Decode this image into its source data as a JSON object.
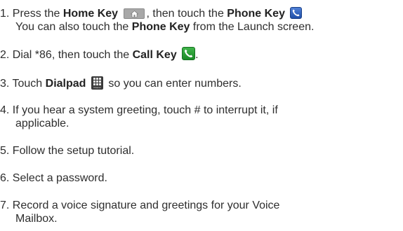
{
  "steps": [
    {
      "line1_pre": "1. Press the ",
      "home_key": "Home Key",
      "line1_mid": ", then touch the ",
      "phone_key": "Phone Key",
      "line2_pre": "You can also touch the ",
      "phone_key_2": "Phone Key",
      "line2_post": " from the Launch screen."
    },
    {
      "pre": "2. Dial *86, then touch the ",
      "call_key": "Call Key",
      "post": "."
    },
    {
      "pre": "3. Touch ",
      "dialpad": "Dialpad",
      "post": " so you can enter numbers.",
      "icon_caption": "Dialpad"
    },
    {
      "line1": "4. If you hear a system greeting, touch # to interrupt it, if",
      "line2": "applicable."
    },
    {
      "text": "5. Follow the setup tutorial."
    },
    {
      "text": "6. Select a password."
    },
    {
      "line1": "7. Record a voice signature and greetings for your Voice",
      "line2": "Mailbox."
    }
  ],
  "icons": {
    "home": "home-key-icon",
    "phone": "phone-key-icon",
    "call": "call-key-icon",
    "dialpad": "dialpad-icon"
  },
  "colors": {
    "text": "#2e2e2e",
    "phone_blue": "#2b5fbf",
    "call_green": "#2aa038",
    "home_gray": "#a8a8a8"
  }
}
